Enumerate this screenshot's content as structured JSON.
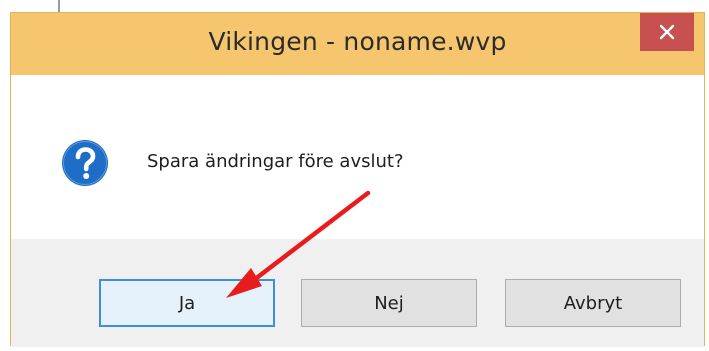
{
  "window": {
    "title": "Vikingen - noname.wvp"
  },
  "dialog": {
    "message": "Spara ändringar före avslut?",
    "icon": "question-icon"
  },
  "buttons": {
    "yes_label": "Ja",
    "no_label": "Nej",
    "cancel_label": "Avbryt"
  },
  "colors": {
    "titlebar": "#f6c66e",
    "close_button": "#c75050",
    "default_button_border": "#3c8fd8",
    "icon_blue": "#1e6ec8",
    "annotation_arrow": "#e81c1c"
  }
}
